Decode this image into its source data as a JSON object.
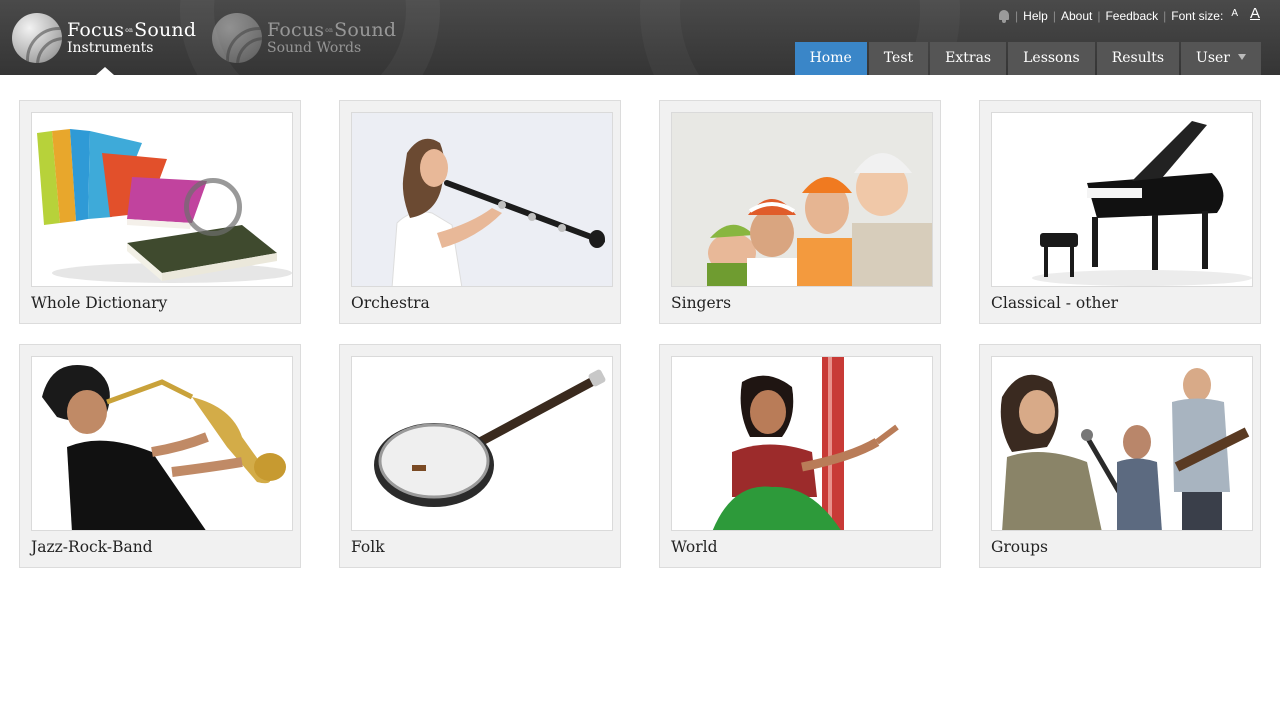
{
  "apps": [
    {
      "name_line1_a": "Focus",
      "name_line1_small": "on",
      "name_line1_b": "Sound",
      "name_line2": "Instruments",
      "active": true
    },
    {
      "name_line1_a": "Focus",
      "name_line1_small": "on",
      "name_line1_b": "Sound",
      "name_line2": "Sound Words",
      "active": false
    }
  ],
  "top_links": {
    "icon": "bell-icon",
    "help": "Help",
    "about": "About",
    "feedback": "Feedback",
    "font_size_label": "Font size:",
    "font_small": "A",
    "font_large": "A"
  },
  "nav": {
    "tabs": [
      {
        "label": "Home",
        "selected": true
      },
      {
        "label": "Test",
        "selected": false
      },
      {
        "label": "Extras",
        "selected": false
      },
      {
        "label": "Lessons",
        "selected": false
      },
      {
        "label": "Results",
        "selected": false
      },
      {
        "label": "User",
        "selected": false,
        "dropdown": true
      }
    ]
  },
  "categories": [
    {
      "label": "Whole Dictionary",
      "image": "stack-of-books"
    },
    {
      "label": "Orchestra",
      "image": "woman-playing-oboe"
    },
    {
      "label": "Singers",
      "image": "group-of-singers-in-hats"
    },
    {
      "label": "Classical - other",
      "image": "grand-piano"
    },
    {
      "label": "Jazz-Rock-Band",
      "image": "man-playing-saxophone"
    },
    {
      "label": "Folk",
      "image": "banjo"
    },
    {
      "label": "World",
      "image": "woman-with-tanpura"
    },
    {
      "label": "Groups",
      "image": "band-with-singer"
    }
  ],
  "colors": {
    "header_bg": "#404040",
    "tab_bg": "#555555",
    "tab_selected": "#3a86c8",
    "tile_bg": "#f1f1f1"
  }
}
